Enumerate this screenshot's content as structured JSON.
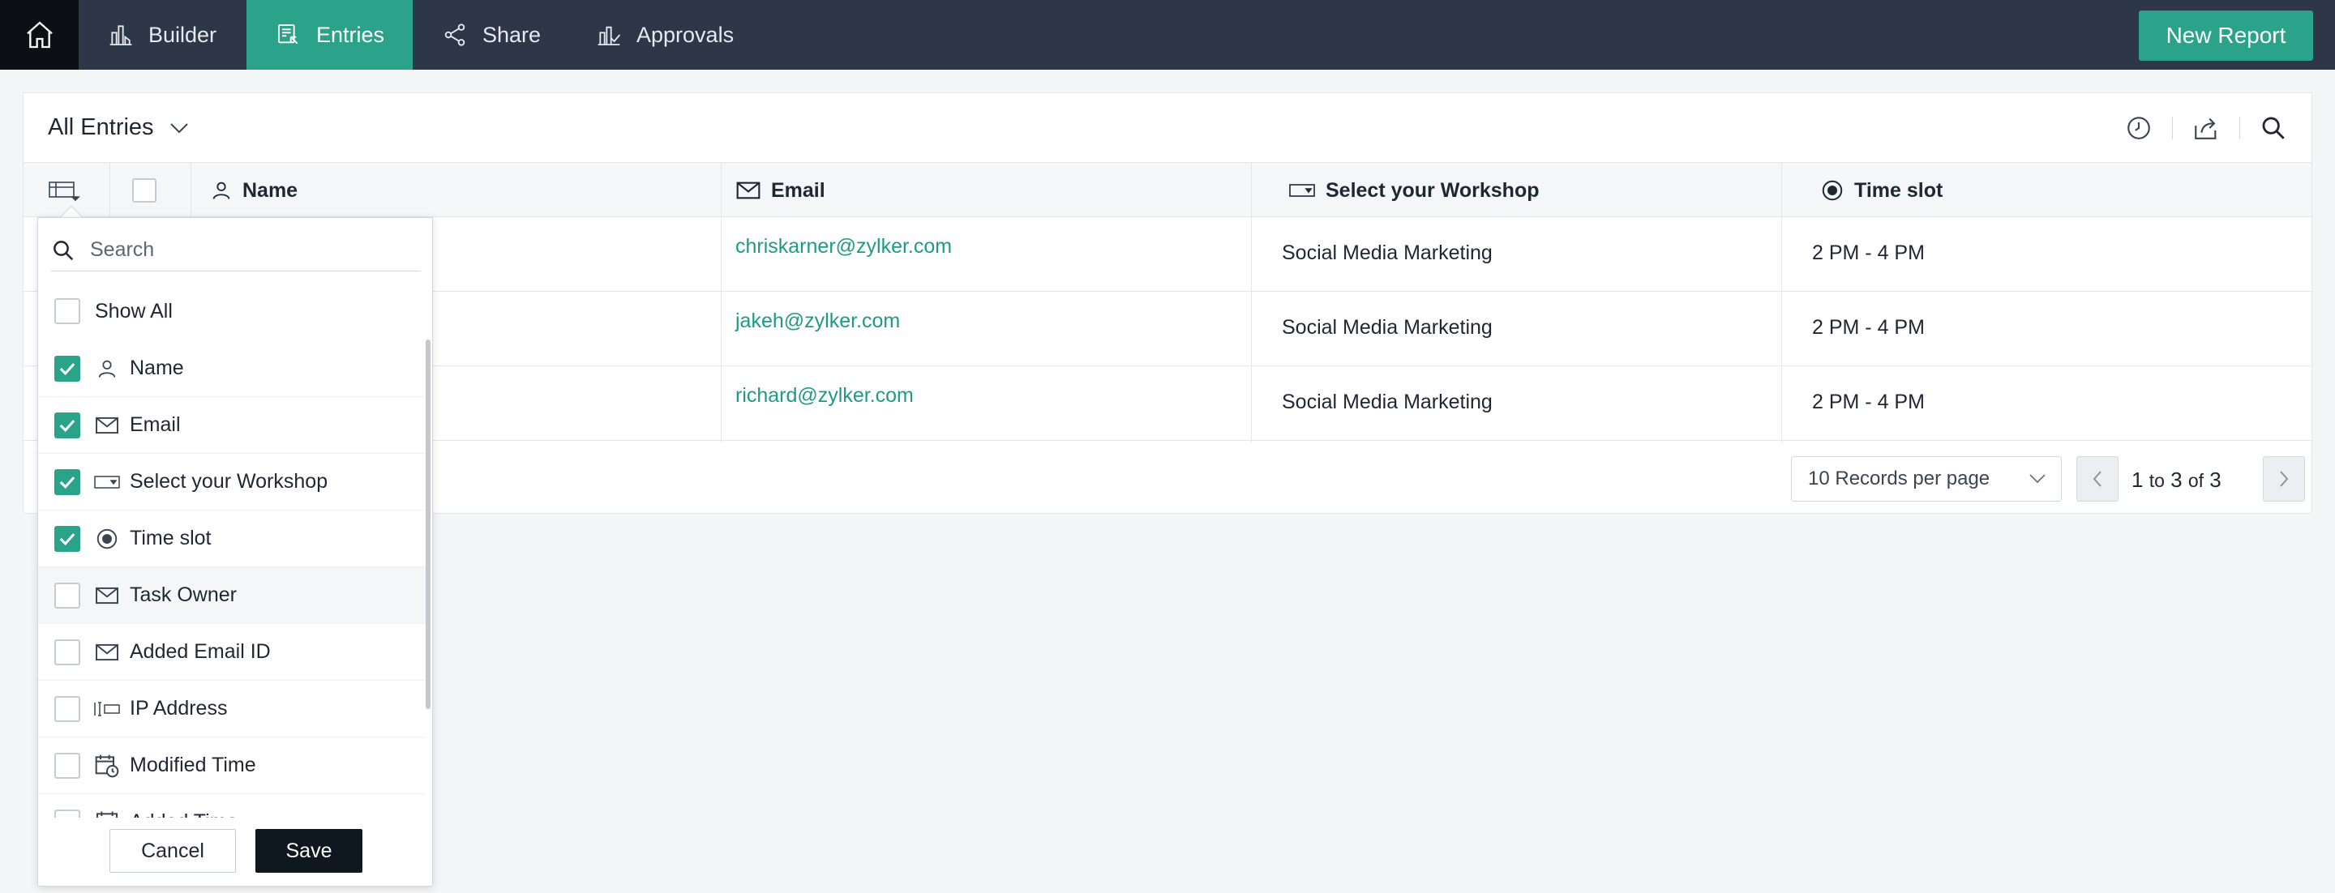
{
  "nav": {
    "tabs": [
      {
        "label": "Builder",
        "icon": "builder-icon"
      },
      {
        "label": "Entries",
        "icon": "entries-icon",
        "active": true
      },
      {
        "label": "Share",
        "icon": "share-icon"
      },
      {
        "label": "Approvals",
        "icon": "approvals-icon"
      }
    ],
    "new_report": "New Report"
  },
  "report": {
    "title": "All Entries",
    "columns": [
      "Name",
      "Email",
      "Select your Workshop",
      "Time slot"
    ],
    "rows": [
      {
        "email": "chriskarner@zylker.com",
        "workshop": "Social Media Marketing",
        "time": "2 PM - 4 PM"
      },
      {
        "email": "jakeh@zylker.com",
        "workshop": "Social Media Marketing",
        "time": "2 PM - 4 PM"
      },
      {
        "email": "richard@zylker.com",
        "workshop": "Social Media Marketing",
        "time": "2 PM - 4 PM"
      }
    ]
  },
  "pagination": {
    "per_page": "10 Records per page",
    "from": "1",
    "to_word": "to",
    "to": "3",
    "of_word": "of",
    "total": "3"
  },
  "column_chooser": {
    "search_placeholder": "Search",
    "show_all": "Show All",
    "items": [
      {
        "label": "Name",
        "checked": true,
        "icon": "person-icon"
      },
      {
        "label": "Email",
        "checked": true,
        "icon": "mail-icon"
      },
      {
        "label": "Select your Workshop",
        "checked": true,
        "icon": "dropdown-field-icon"
      },
      {
        "label": "Time slot",
        "checked": true,
        "icon": "radio-icon"
      },
      {
        "label": "Task Owner",
        "checked": false,
        "icon": "mail-icon"
      },
      {
        "label": "Added Email ID",
        "checked": false,
        "icon": "mail-icon"
      },
      {
        "label": "IP Address",
        "checked": false,
        "icon": "ip-address-icon"
      },
      {
        "label": "Modified Time",
        "checked": false,
        "icon": "calendar-clock-icon"
      },
      {
        "label": "Added Time",
        "checked": false,
        "icon": "calendar-icon"
      }
    ],
    "cancel": "Cancel",
    "save": "Save"
  },
  "colors": {
    "accent": "#2ba38b",
    "nav_bg": "#2d3748",
    "link": "#1e9b82"
  }
}
